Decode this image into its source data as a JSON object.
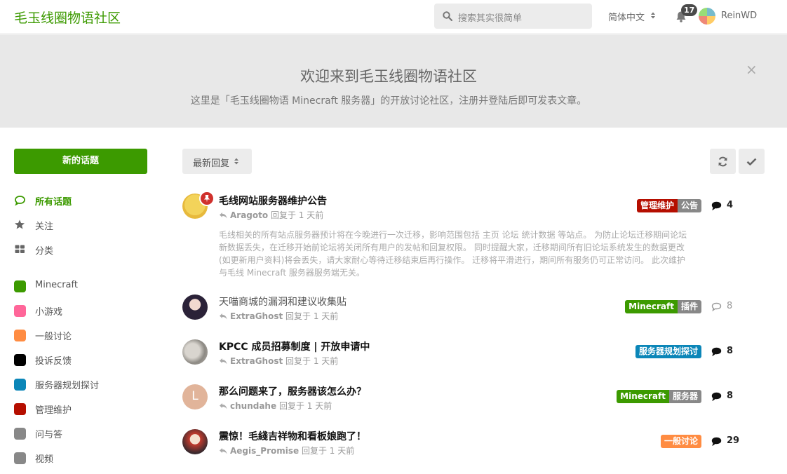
{
  "header": {
    "brand": "毛玉线圈物语社区",
    "search_placeholder": "搜索其实很简单",
    "language": "简体中文",
    "notif_count": "17",
    "username": "ReinWD"
  },
  "hero": {
    "title": "欢迎来到毛玉线圈物语社区",
    "subtitle": "这里是「毛玉线圈物语 Minecraft 服务器」的开放讨论社区，注册并登陆后即可发表文章。",
    "close": "×"
  },
  "sidebar": {
    "new_discussion": "新的话题",
    "nav": [
      {
        "label": "所有话题",
        "icon": "comments-icon"
      },
      {
        "label": "关注",
        "icon": "star-icon"
      },
      {
        "label": "分类",
        "icon": "grid-icon"
      }
    ],
    "tags": [
      {
        "label": "Minecraft",
        "color": "#3c9a00"
      },
      {
        "label": "小游戏",
        "color": "#ff6699"
      },
      {
        "label": "一般讨论",
        "color": "#ff8c42"
      },
      {
        "label": "投诉反馈",
        "color": "#000000"
      },
      {
        "label": "服务器规划探讨",
        "color": "#0b86b8"
      },
      {
        "label": "管理维护",
        "color": "#b50e00"
      },
      {
        "label": "问与答",
        "color": "#888888"
      },
      {
        "label": "视频",
        "color": "#888888"
      }
    ]
  },
  "toolbar": {
    "sort_label": "最新回复"
  },
  "discussions": [
    {
      "title": "毛线网站服务器维护公告",
      "user": "Aragoto",
      "meta": "回复于 1 天前",
      "excerpt": "毛线相关的所有站点服务器预计将在今晚进行一次迁移，影响范围包括 主页 论坛 统计数据 等站点。 为防止论坛迁移期间论坛新数据丢失，在迁移开始前论坛将关闭所有用户的发帖和回复权限。 同时提醒大家，迁移期间所有旧论坛系统发生的数据更改(如更新用户资料)将会丢失，请大家耐心等待迁移结束后再行操作。 迁移将平滑进行，期间所有服务仍可正常访问。 此次维护与毛线 Minecraft 服务器服务端无关。",
      "tags": [
        {
          "label": "管理维护",
          "color": "#b50e00"
        },
        {
          "label": "公告",
          "color": "#888888"
        }
      ],
      "replies": "4",
      "read": false,
      "pinned": true
    },
    {
      "title": "天喵商城的漏洞和建议收集贴",
      "user": "ExtraGhost",
      "meta": "回复于 1 天前",
      "tags": [
        {
          "label": "Minecraft",
          "color": "#3c9a00"
        },
        {
          "label": "插件",
          "color": "#888888"
        }
      ],
      "replies": "8",
      "read": true
    },
    {
      "title": "KPCC 成员招募制度 | 开放申请中",
      "user": "ExtraGhost",
      "meta": "回复于 1 天前",
      "tags": [
        {
          "label": "服务器规划探讨",
          "color": "#0b86b8"
        }
      ],
      "replies": "8",
      "read": false
    },
    {
      "title": "那么问题来了，服务器该怎么办？",
      "user": "chundahe",
      "meta": "回复于 1 天前",
      "avatar_letter": "L",
      "tags": [
        {
          "label": "Minecraft",
          "color": "#3c9a00"
        },
        {
          "label": "服务器",
          "color": "#888888"
        }
      ],
      "replies": "8",
      "read": false
    },
    {
      "title": "震惊！毛綫吉祥物和看板娘跑了！",
      "user": "Aegis_Promise",
      "meta": "回复于 1 天前",
      "tags": [
        {
          "label": "一般讨论",
          "color": "#ff8c42"
        }
      ],
      "replies": "29",
      "read": false
    }
  ]
}
